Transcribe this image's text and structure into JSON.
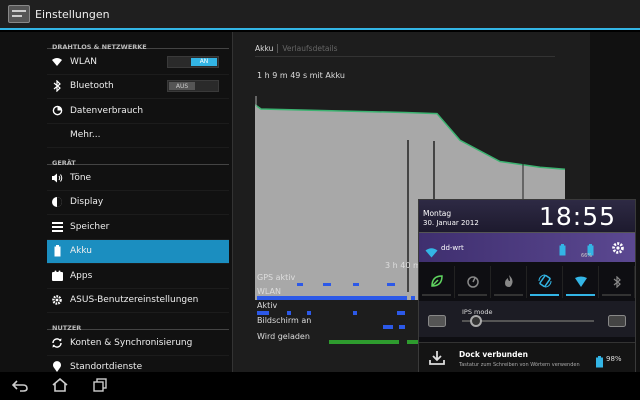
{
  "actionbar": {
    "title": "Einstellungen"
  },
  "sidebar": {
    "sections": [
      {
        "header": "DRAHTLOS & NETZWERKE"
      },
      {
        "header": "GERÄT"
      },
      {
        "header": "NUTZER"
      }
    ],
    "items": [
      {
        "label": "WLAN",
        "icon": "wifi-icon",
        "toggle": "AN"
      },
      {
        "label": "Bluetooth",
        "icon": "bluetooth-icon",
        "toggle": "AUS"
      },
      {
        "label": "Datenverbrauch",
        "icon": "data-usage-icon"
      },
      {
        "label": "Mehr..."
      },
      {
        "label": "Töne",
        "icon": "volume-icon"
      },
      {
        "label": "Display",
        "icon": "brightness-icon"
      },
      {
        "label": "Speicher",
        "icon": "storage-icon"
      },
      {
        "label": "Akku",
        "icon": "battery-icon",
        "selected": true
      },
      {
        "label": "Apps",
        "icon": "apps-icon"
      },
      {
        "label": "ASUS-Benutzereinstellungen",
        "icon": "gear-icon"
      },
      {
        "label": "Konten & Synchronisierung",
        "icon": "sync-icon"
      },
      {
        "label": "Standortdienste",
        "icon": "location-icon"
      }
    ]
  },
  "battery_panel": {
    "tabs": [
      "Akku",
      "Verlaufsdetails"
    ],
    "duration": "1 h 9 m 49 s mit Akku",
    "graph_time": "3 h 40 m",
    "legend": [
      "GPS aktiv",
      "WLAN",
      "Aktiv",
      "Bildschirm an",
      "Wird geladen"
    ],
    "battery_level_start": 0.9,
    "battery_level_end": 0.59,
    "colors": {
      "graph_fill": "#a8a8a8",
      "graph_line": "#3cb371",
      "bar_blue": "#2c59e8",
      "bar_green": "#2e9b2e"
    }
  },
  "notification": {
    "day": "Montag",
    "date": "30. Januar 2012",
    "time": "18:55",
    "wifi_name": "dd-wrt",
    "battery1_pct": "",
    "battery2_pct": "66%",
    "ips_label": "IPS mode",
    "quick_settings": [
      "eco-mode-icon",
      "performance-icon",
      "flame-icon",
      "auto-rotate-icon",
      "wifi-icon",
      "bluetooth-icon"
    ],
    "dock_title": "Dock verbunden",
    "dock_subtitle": "Tastatur zum Schreiben von Wörtern verwenden",
    "dock_pct": "98%"
  },
  "navbar": {
    "buttons": [
      "back-icon",
      "home-icon",
      "recent-apps-icon"
    ]
  }
}
